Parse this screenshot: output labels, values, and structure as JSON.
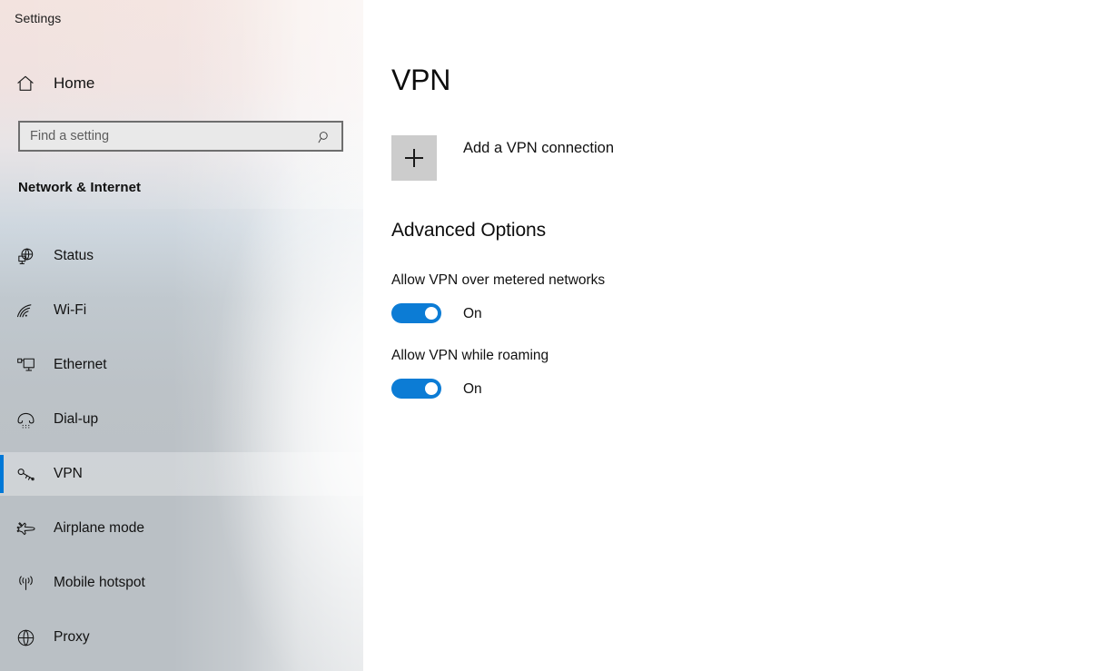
{
  "window": {
    "app_title": "Settings"
  },
  "sidebar": {
    "home_label": "Home",
    "home_icon": "home-icon",
    "search": {
      "placeholder": "Find a setting",
      "value": "",
      "icon": "search-icon"
    },
    "category_title": "Network & Internet",
    "items": [
      {
        "label": "Status",
        "icon": "globe-monitor-icon",
        "selected": false
      },
      {
        "label": "Wi-Fi",
        "icon": "wifi-icon",
        "selected": false
      },
      {
        "label": "Ethernet",
        "icon": "ethernet-icon",
        "selected": false
      },
      {
        "label": "Dial-up",
        "icon": "phone-handset-icon",
        "selected": false
      },
      {
        "label": "VPN",
        "icon": "vpn-key-icon",
        "selected": true
      },
      {
        "label": "Airplane mode",
        "icon": "airplane-icon",
        "selected": false
      },
      {
        "label": "Mobile hotspot",
        "icon": "hotspot-icon",
        "selected": false
      },
      {
        "label": "Proxy",
        "icon": "globe-icon",
        "selected": false
      }
    ]
  },
  "main": {
    "page_title": "VPN",
    "add_vpn": {
      "label": "Add a VPN connection",
      "icon": "plus-icon"
    },
    "advanced_section_title": "Advanced Options",
    "settings": [
      {
        "label": "Allow VPN over metered networks",
        "state": "On",
        "checked": true
      },
      {
        "label": "Allow VPN while roaming",
        "state": "On",
        "checked": true
      }
    ]
  },
  "colors": {
    "accent": "#0078d7",
    "toggle_on": "#0c7cd5",
    "add_box": "#cccccc",
    "search_border": "#6e6e6e",
    "search_fill": "#e9e9e9"
  }
}
